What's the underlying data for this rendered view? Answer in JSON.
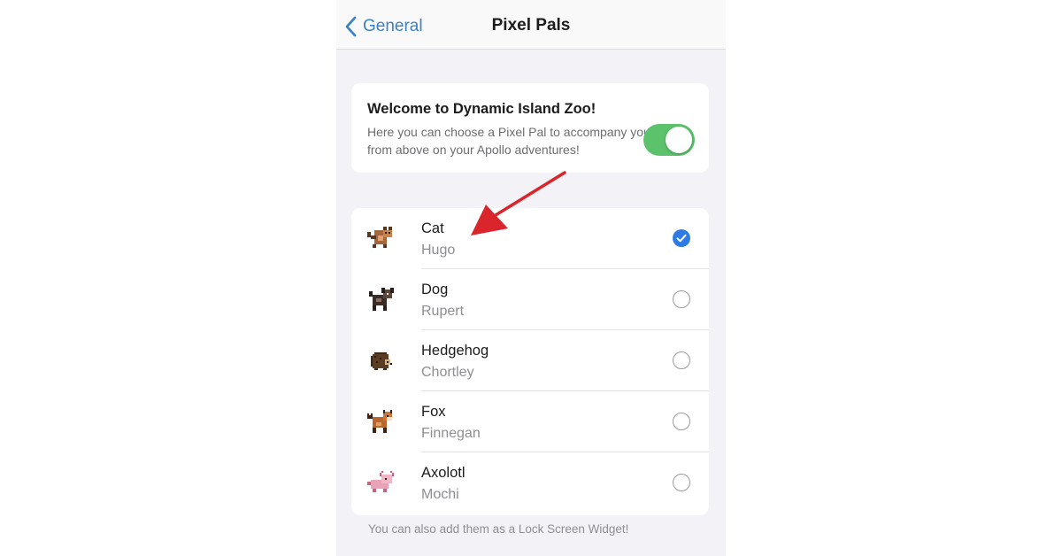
{
  "navbar": {
    "back_label": "General",
    "title": "Pixel Pals"
  },
  "welcome": {
    "title": "Welcome to Dynamic Island Zoo!",
    "description": "Here you can choose a Pixel Pal to accompany you from above on your Apollo adventures!",
    "toggle_on": true
  },
  "pals": [
    {
      "name": "Cat",
      "pet_name": "Hugo",
      "selected": true,
      "icon": "cat-sprite-icon"
    },
    {
      "name": "Dog",
      "pet_name": "Rupert",
      "selected": false,
      "icon": "dog-sprite-icon"
    },
    {
      "name": "Hedgehog",
      "pet_name": "Chortley",
      "selected": false,
      "icon": "hedgehog-sprite-icon"
    },
    {
      "name": "Fox",
      "pet_name": "Finnegan",
      "selected": false,
      "icon": "fox-sprite-icon"
    },
    {
      "name": "Axolotl",
      "pet_name": "Mochi",
      "selected": false,
      "icon": "axolotl-sprite-icon"
    }
  ],
  "footer_note": "You can also add them as a Lock Screen Widget!",
  "colors": {
    "accent": "#3b82c4",
    "checkmark": "#2f7be6",
    "toggle_on": "#5cc26b",
    "annotation_arrow": "#d9252b"
  }
}
